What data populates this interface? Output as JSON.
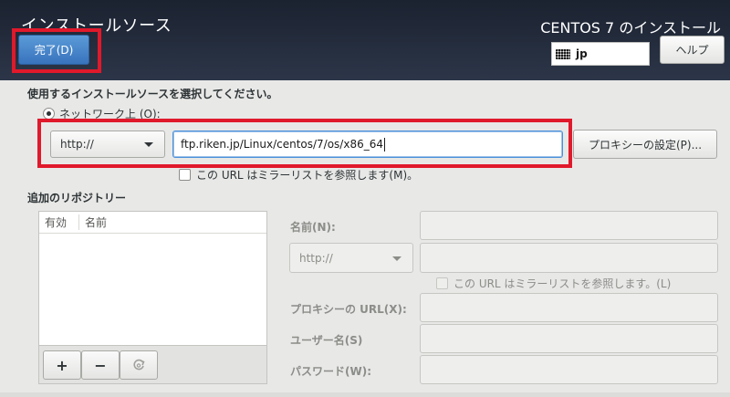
{
  "header": {
    "title": "インストールソース",
    "product_title": "CENTOS 7 のインストール",
    "done_button": "完了(D)",
    "help_button": "ヘルプ",
    "keyboard_layout": "jp",
    "keyboard_icon": "keyboard-icon"
  },
  "source": {
    "section_label": "使用するインストールソースを選択してください。",
    "network_radio_label": "ネットワーク上 (O):",
    "protocol_selected": "http://",
    "url_value": "ftp.riken.jp/Linux/centos/7/os/x86_64",
    "proxy_button": "プロキシーの設定(P)...",
    "mirror_checkbox_label": "この URL はミラーリストを参照します(M)。"
  },
  "repositories": {
    "section_label": "追加のリポジトリー",
    "columns": [
      "有効",
      "名前"
    ],
    "add_button": "+",
    "remove_button": "−",
    "refresh_icon": "refresh-icon"
  },
  "repo_form": {
    "name_label": "名前(N):",
    "protocol_selected": "http://",
    "mirror_checkbox_label": "この URL はミラーリストを参照します。(L)",
    "proxy_url_label": "プロキシーの URL(X):",
    "username_label": "ユーザー名(S)",
    "password_label": "パスワード(W):"
  },
  "colors": {
    "header_bg": "#1b2230",
    "accent_blue": "#3873bd",
    "highlight_red": "#e0192b"
  }
}
